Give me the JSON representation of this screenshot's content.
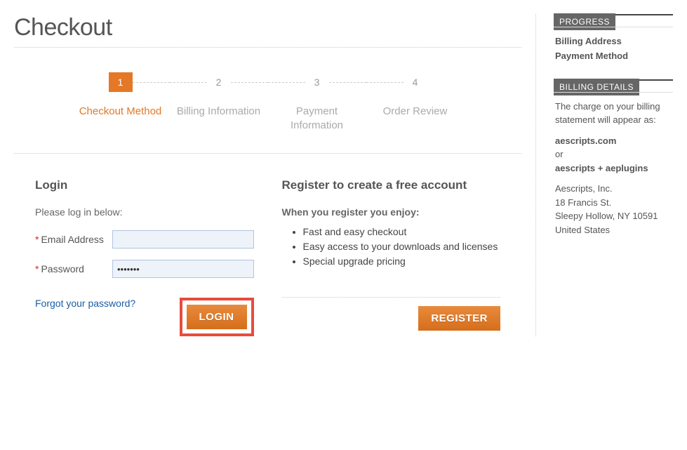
{
  "page_title": "Checkout",
  "steps": [
    {
      "num": "1",
      "label": "Checkout Method",
      "active": true
    },
    {
      "num": "2",
      "label": "Billing Information",
      "active": false
    },
    {
      "num": "3",
      "label": "Payment Information",
      "active": false
    },
    {
      "num": "4",
      "label": "Order Review",
      "active": false
    }
  ],
  "login": {
    "heading": "Login",
    "instruction": "Please log in below:",
    "email_label": "Email Address",
    "password_label": "Password",
    "email_value": "",
    "password_value": "•••••••",
    "forgot": "Forgot your password?",
    "button": "LOGIN"
  },
  "register": {
    "heading": "Register to create a free account",
    "subheading": "When you register you enjoy:",
    "benefits": [
      "Fast and easy checkout",
      "Easy access to your downloads and licenses",
      "Special upgrade pricing"
    ],
    "button": "REGISTER"
  },
  "sidebar": {
    "progress_header": "PROGRESS",
    "progress_links": [
      "Billing Address",
      "Payment Method"
    ],
    "billing_header": "BILLING DETAILS",
    "billing_intro": "The charge on your billing statement will appear as:",
    "billing_name1": "aescripts.com",
    "billing_or": "or",
    "billing_name2": "aescripts + aeplugins",
    "address_lines": [
      "Aescripts, Inc.",
      "18 Francis St.",
      "Sleepy Hollow, NY 10591",
      "United States"
    ]
  }
}
